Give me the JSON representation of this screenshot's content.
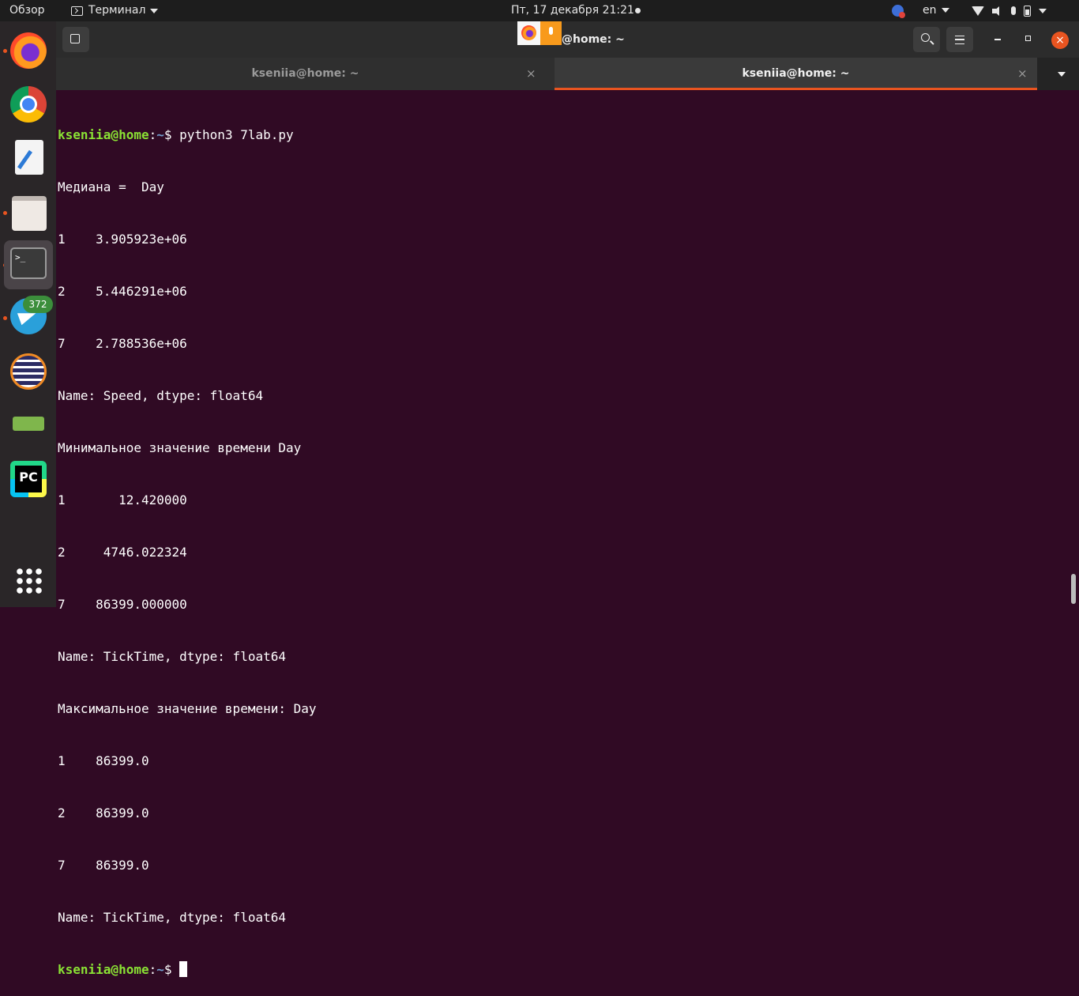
{
  "topbar": {
    "activities": "Обзор",
    "app_menu": "Терминал",
    "clock": "Пт, 17 декабря  21:21",
    "language": "en"
  },
  "dock": {
    "items": [
      {
        "name": "firefox"
      },
      {
        "name": "chrome"
      },
      {
        "name": "text-editor"
      },
      {
        "name": "files"
      },
      {
        "name": "terminal"
      },
      {
        "name": "telegram",
        "badge": "372"
      },
      {
        "name": "eclipse"
      },
      {
        "name": "serial-tool"
      },
      {
        "name": "pycharm"
      }
    ]
  },
  "window": {
    "title": "@home: ~",
    "tabs": [
      {
        "label": "kseniia@home: ~",
        "close": "×"
      },
      {
        "label": "kseniia@home: ~",
        "close": "×"
      }
    ],
    "close_glyph": "×"
  },
  "terminal": {
    "user_host": "kseniia@home",
    "colon": ":",
    "path": "~",
    "prompt_symbol": "$ ",
    "command": "python3 7lab.py",
    "output": [
      "Медиана =  Day",
      "1    3.905923e+06",
      "2    5.446291e+06",
      "7    2.788536e+06",
      "Name: Speed, dtype: float64",
      "Минимальное значение времени Day",
      "1       12.420000",
      "2     4746.022324",
      "7    86399.000000",
      "Name: TickTime, dtype: float64",
      "Максимальное значение времени: Day",
      "1    86399.0",
      "2    86399.0",
      "7    86399.0",
      "Name: TickTime, dtype: float64"
    ]
  },
  "colors": {
    "terminal_bg": "#300a24",
    "prompt_user": "#8ae234",
    "prompt_path": "#729fcf",
    "accent": "#e95420"
  }
}
